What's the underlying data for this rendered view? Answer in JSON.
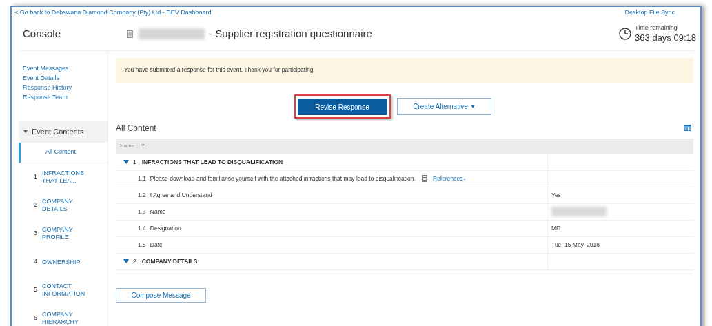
{
  "back_link": "< Go back to Debswana Diamond Company (Pty) Ltd - DEV Dashboard",
  "desktop_sync": "Desktop File Sync",
  "console_title": "Console",
  "page_title": {
    "redacted_prefix": true,
    "text": "- Supplier registration questionnaire"
  },
  "time_remaining": {
    "label": "Time remaining",
    "value": "363 days 09:18"
  },
  "sidebar": {
    "links": [
      "Event Messages",
      "Event Details",
      "Response History",
      "Response Team"
    ],
    "event_contents": {
      "label": "Event Contents",
      "expanded": true
    },
    "items": [
      {
        "label": "All Content",
        "selected": true
      },
      {
        "number": "1",
        "label": "INFRACTIONS THAT LEA...",
        "selected": false
      },
      {
        "number": "2",
        "label": "COMPANY DETAILS",
        "selected": false
      },
      {
        "number": "3",
        "label": "COMPANY PROFILE",
        "selected": false
      },
      {
        "number": "4",
        "label": "OWNERSHIP",
        "selected": false
      },
      {
        "number": "5",
        "label": "CONTACT INFORMATION",
        "selected": false
      },
      {
        "number": "6",
        "label": "COMPANY HIERARCHY",
        "selected": false
      }
    ]
  },
  "notice": "You have submitted a response for this event.  Thank you for participating.",
  "buttons": {
    "revise": "Revise Response",
    "create_alternative": "Create Alternative"
  },
  "content_title": "All Content",
  "table": {
    "columns": [
      "Name"
    ],
    "rows": [
      {
        "kind": "section",
        "number": "1",
        "text": "INFRACTIONS THAT LEAD TO DISQUALIFICATION",
        "expanded": true
      },
      {
        "kind": "question",
        "number": "1.1",
        "text": "Please download and familiarise yourself with the attached infractions that may lead to disqualification.",
        "link": "References"
      },
      {
        "kind": "question",
        "number": "1.2",
        "text": "I Agree and Understand",
        "value": "Yes"
      },
      {
        "kind": "question",
        "number": "1.3",
        "text": "Name",
        "redacted": true
      },
      {
        "kind": "question",
        "number": "1.4",
        "text": "Designation",
        "value": "MD"
      },
      {
        "kind": "question",
        "number": "1.5",
        "text": "Date",
        "value": "Tue, 15 May, 2018"
      },
      {
        "kind": "section",
        "number": "2",
        "text": "COMPANY DETAILS",
        "expanded": true
      }
    ]
  },
  "compose": "Compose Message"
}
